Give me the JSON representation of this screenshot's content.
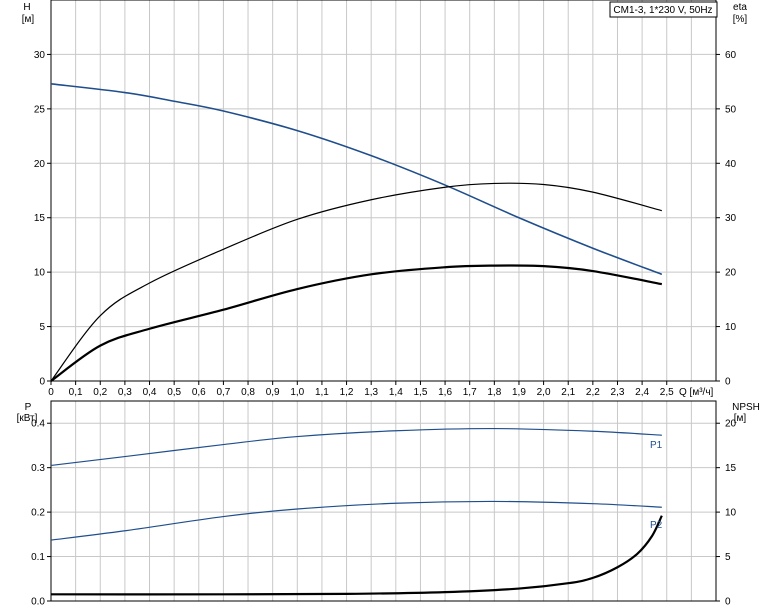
{
  "chart_data": [
    {
      "type": "line",
      "title": "CM1-3, 1*230 V, 50Hz",
      "xlabel": "Q [м³/ч]",
      "x_ticks": [
        "0",
        "0,1",
        "0,2",
        "0,3",
        "0,4",
        "0,5",
        "0,6",
        "0,7",
        "0,8",
        "0,9",
        "1,0",
        "1,1",
        "1,2",
        "1,3",
        "1,4",
        "1,5",
        "1,6",
        "1,7",
        "1,8",
        "1,9",
        "2,0",
        "2,1",
        "2,2",
        "2,3",
        "2,4",
        "2,5"
      ],
      "xlim": [
        0,
        2.7
      ],
      "y_left": {
        "label": "H",
        "unit": "[м]",
        "ticks": [
          "0",
          "5",
          "10",
          "15",
          "20",
          "25",
          "30"
        ],
        "lim": [
          0,
          35
        ]
      },
      "y_right": {
        "label": "eta",
        "unit": "[%]",
        "ticks": [
          "0",
          "10",
          "20",
          "30",
          "40",
          "50",
          "60"
        ],
        "lim": [
          0,
          70
        ]
      },
      "grid": true,
      "series": [
        {
          "axis": "left",
          "color": "#1f4e8c",
          "x": [
            0,
            0.3,
            0.5,
            0.7,
            1.0,
            1.3,
            1.6,
            1.9,
            2.2,
            2.48
          ],
          "y": [
            27.3,
            26.5,
            25.7,
            24.8,
            23.0,
            20.7,
            18.0,
            15.0,
            12.2,
            9.8
          ]
        },
        {
          "axis": "right",
          "color": "#000000",
          "x": [
            0,
            0.2,
            0.4,
            0.7,
            1.0,
            1.3,
            1.6,
            1.8,
            2.0,
            2.2,
            2.48
          ],
          "y": [
            0,
            12.0,
            18.0,
            24.2,
            29.7,
            33.3,
            35.6,
            36.3,
            36.1,
            34.7,
            31.3
          ]
        },
        {
          "axis": "right",
          "color": "#000000",
          "x": [
            0,
            0.2,
            0.4,
            0.7,
            1.0,
            1.3,
            1.6,
            1.8,
            2.0,
            2.2,
            2.48
          ],
          "y": [
            0,
            6.5,
            9.6,
            13.1,
            16.9,
            19.6,
            20.9,
            21.2,
            21.1,
            20.2,
            17.8
          ]
        }
      ]
    },
    {
      "type": "line",
      "xlim": [
        0,
        2.7
      ],
      "y_left": {
        "label": "P",
        "unit": "[кВт]",
        "ticks": [
          "0.0",
          "0.1",
          "0.2",
          "0.3",
          "0.4"
        ],
        "lim": [
          0,
          0.45
        ]
      },
      "y_right": {
        "label": "NPSH",
        "unit": "[м]",
        "ticks": [
          "0",
          "5",
          "10",
          "15",
          "20"
        ],
        "lim": [
          0,
          22.5
        ]
      },
      "grid": true,
      "series": [
        {
          "name": "P1",
          "axis": "left",
          "color": "#1f4e8c",
          "x": [
            0,
            0.3,
            0.7,
            1.0,
            1.4,
            1.8,
            2.2,
            2.48
          ],
          "y": [
            0.305,
            0.325,
            0.352,
            0.37,
            0.383,
            0.388,
            0.382,
            0.373
          ]
        },
        {
          "name": "P2",
          "axis": "left",
          "color": "#1f4e8c",
          "x": [
            0,
            0.3,
            0.7,
            1.0,
            1.4,
            1.8,
            2.2,
            2.48
          ],
          "y": [
            0.137,
            0.158,
            0.19,
            0.207,
            0.22,
            0.224,
            0.219,
            0.211
          ]
        },
        {
          "axis": "right",
          "color": "#000000",
          "x": [
            0,
            0.7,
            1.2,
            1.6,
            1.9,
            2.1,
            2.2,
            2.3,
            2.38,
            2.44,
            2.48
          ],
          "y": [
            0.75,
            0.75,
            0.8,
            1.0,
            1.4,
            2.0,
            2.6,
            3.8,
            5.3,
            7.3,
            9.6
          ]
        }
      ]
    }
  ]
}
